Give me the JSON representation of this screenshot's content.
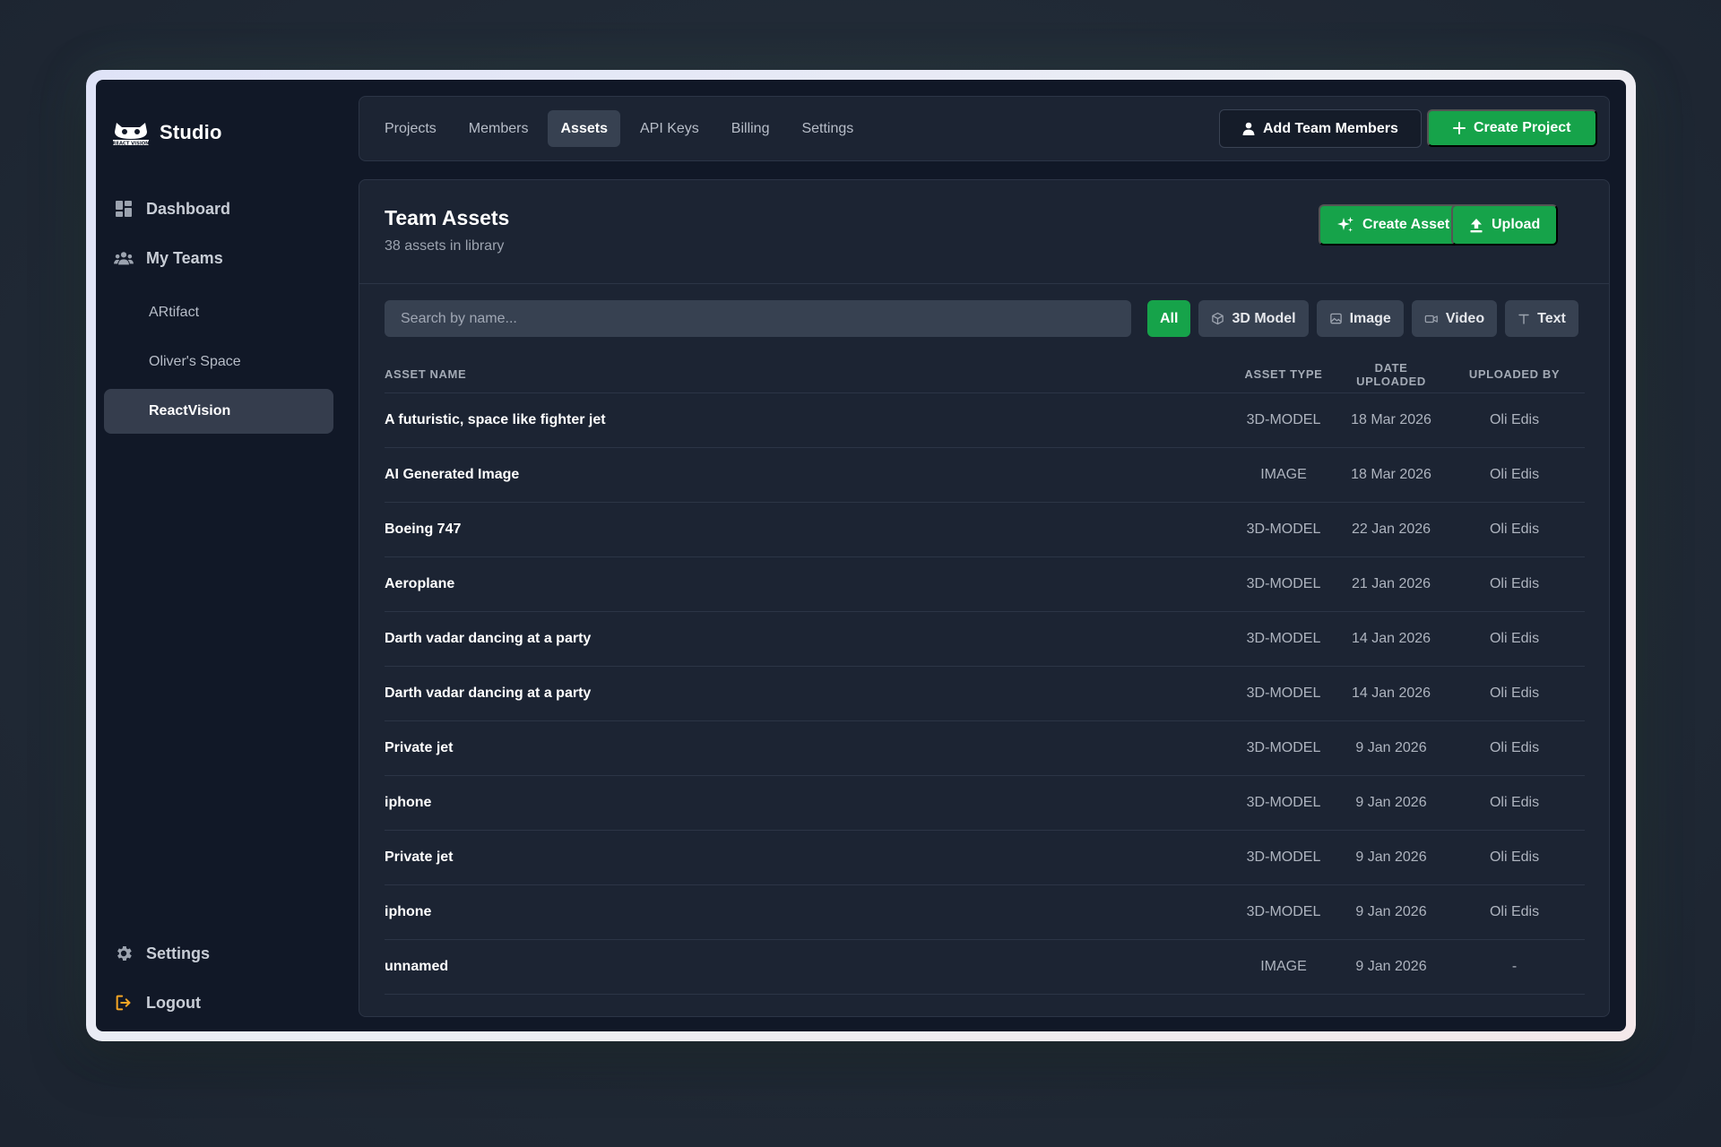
{
  "sidebar": {
    "brand": {
      "name": "Studio",
      "logo_icon": "react-vision-logo"
    },
    "nav": [
      {
        "label": "Dashboard",
        "icon": "dashboard-icon"
      },
      {
        "label": "My Teams",
        "icon": "team-icon"
      }
    ],
    "teams": [
      {
        "label": "ARtifact",
        "active": false
      },
      {
        "label": "Oliver's Space",
        "active": false
      },
      {
        "label": "ReactVision",
        "active": true
      }
    ],
    "footer": [
      {
        "label": "Settings",
        "icon": "gear-icon"
      },
      {
        "label": "Logout",
        "icon": "logout-icon"
      }
    ]
  },
  "topbar": {
    "tabs": [
      {
        "label": "Projects",
        "active": false
      },
      {
        "label": "Members",
        "active": false
      },
      {
        "label": "Assets",
        "active": true
      },
      {
        "label": "API Keys",
        "active": false
      },
      {
        "label": "Billing",
        "active": false
      },
      {
        "label": "Settings",
        "active": false
      }
    ],
    "add_members_label": "Add Team Members",
    "create_project_label": "Create Project"
  },
  "panel": {
    "title": "Team Assets",
    "subtitle": "38 assets in library",
    "create_asset_label": "Create Asset",
    "upload_label": "Upload",
    "search": {
      "placeholder": "Search by name...",
      "value": ""
    },
    "filters": [
      {
        "label": "All",
        "icon": "",
        "active": true
      },
      {
        "label": "3D Model",
        "icon": "cube-icon",
        "active": false
      },
      {
        "label": "Image",
        "icon": "image-icon",
        "active": false
      },
      {
        "label": "Video",
        "icon": "video-icon",
        "active": false
      },
      {
        "label": "Text",
        "icon": "text-icon",
        "active": false
      }
    ],
    "table": {
      "columns": [
        "ASSET NAME",
        "ASSET TYPE",
        "DATE UPLOADED",
        "UPLOADED BY"
      ],
      "rows": [
        {
          "name": "A futuristic, space like fighter jet",
          "type": "3D-MODEL",
          "date": "18 Mar 2026",
          "by": "Oli Edis"
        },
        {
          "name": "AI Generated Image",
          "type": "IMAGE",
          "date": "18 Mar 2026",
          "by": "Oli Edis"
        },
        {
          "name": "Boeing 747",
          "type": "3D-MODEL",
          "date": "22 Jan 2026",
          "by": "Oli Edis"
        },
        {
          "name": "Aeroplane",
          "type": "3D-MODEL",
          "date": "21 Jan 2026",
          "by": "Oli Edis"
        },
        {
          "name": "Darth vadar dancing at a party",
          "type": "3D-MODEL",
          "date": "14 Jan 2026",
          "by": "Oli Edis"
        },
        {
          "name": "Darth vadar dancing at a party",
          "type": "3D-MODEL",
          "date": "14 Jan 2026",
          "by": "Oli Edis"
        },
        {
          "name": "Private jet",
          "type": "3D-MODEL",
          "date": "9 Jan 2026",
          "by": "Oli Edis"
        },
        {
          "name": "iphone",
          "type": "3D-MODEL",
          "date": "9 Jan 2026",
          "by": "Oli Edis"
        },
        {
          "name": "Private jet",
          "type": "3D-MODEL",
          "date": "9 Jan 2026",
          "by": "Oli Edis"
        },
        {
          "name": "iphone",
          "type": "3D-MODEL",
          "date": "9 Jan 2026",
          "by": "Oli Edis"
        },
        {
          "name": "unnamed",
          "type": "IMAGE",
          "date": "9 Jan 2026",
          "by": "-"
        }
      ]
    }
  },
  "colors": {
    "accent_green": "#16a34a",
    "app_bg": "#111827",
    "panel_bg": "#1c2433",
    "logout_icon": "#f5a524"
  }
}
